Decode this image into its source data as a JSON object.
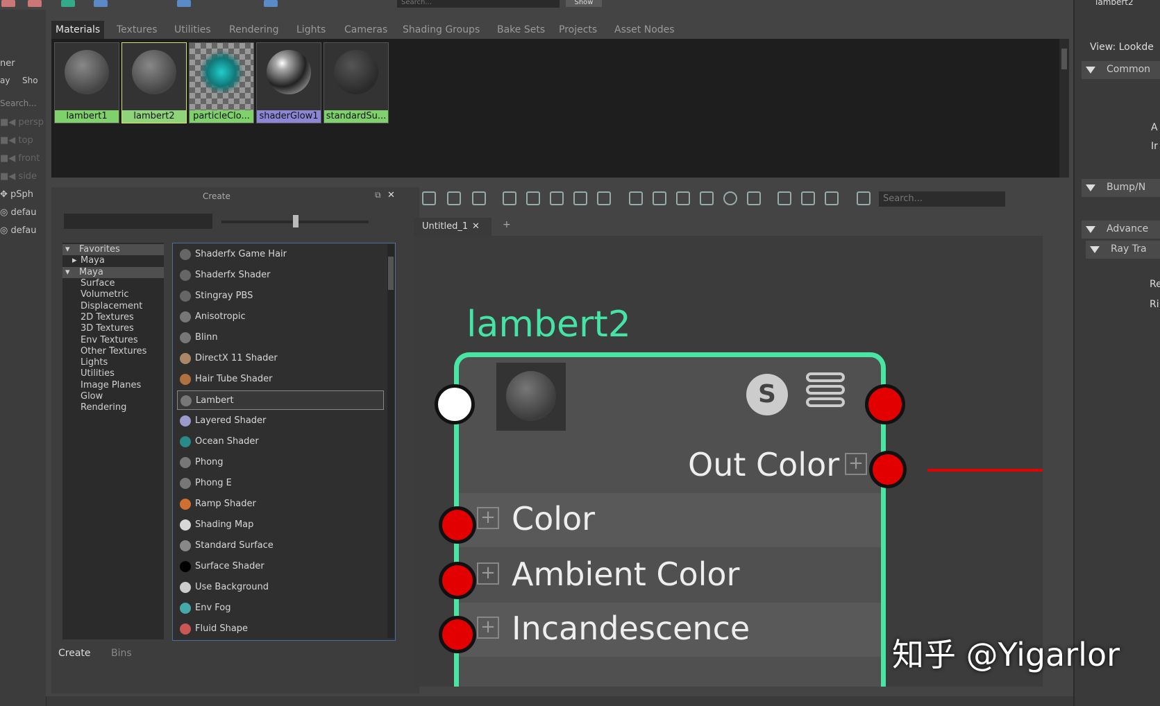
{
  "top_toolbar": {
    "search_placeholder": "Search...",
    "show_button": "Show"
  },
  "outliner": {
    "header_fragments": [
      "ner",
      "ay",
      "Sho"
    ],
    "search_placeholder": "Search...",
    "cameras": [
      "persp",
      "top",
      "front",
      "side"
    ],
    "objects": [
      "pSph",
      "defau",
      "defau"
    ]
  },
  "browser": {
    "tabs": [
      "Materials",
      "Textures",
      "Utilities",
      "Rendering",
      "Lights",
      "Cameras",
      "Shading Groups",
      "Bake Sets",
      "Projects",
      "Asset Nodes"
    ],
    "active_tab": "Materials",
    "swatches": [
      {
        "label": "lambert1",
        "label_bg": "#7ed16b",
        "ball": "lambert"
      },
      {
        "label": "lambert2",
        "label_bg": "#8fd37a",
        "ball": "lambert",
        "selected": true
      },
      {
        "label": "particleClo...",
        "label_bg": "#7ed16b",
        "ball": "checker"
      },
      {
        "label": "shaderGlow1",
        "label_bg": "#8d86d6",
        "ball": "glossy"
      },
      {
        "label": "standardSu...",
        "label_bg": "#7ed16b",
        "ball": "dark"
      }
    ]
  },
  "create_panel": {
    "title": "Create",
    "categories": [
      {
        "label": "Favorites",
        "arrow": "down",
        "level": 0,
        "highlight": true
      },
      {
        "label": "Maya",
        "arrow": "right",
        "level": 1
      },
      {
        "label": "Maya",
        "arrow": "down",
        "level": 0,
        "highlight": true
      },
      {
        "label": "Surface",
        "level": 2
      },
      {
        "label": "Volumetric",
        "level": 2
      },
      {
        "label": "Displacement",
        "level": 2
      },
      {
        "label": "2D Textures",
        "level": 2
      },
      {
        "label": "3D Textures",
        "level": 2
      },
      {
        "label": "Env Textures",
        "level": 2
      },
      {
        "label": "Other Textures",
        "level": 2
      },
      {
        "label": "Lights",
        "level": 2
      },
      {
        "label": "Utilities",
        "level": 2
      },
      {
        "label": "Image Planes",
        "level": 2
      },
      {
        "label": "Glow",
        "level": 2
      },
      {
        "label": "Rendering",
        "level": 2
      }
    ],
    "nodes": [
      {
        "label": "Shaderfx Game Hair",
        "color": "#666"
      },
      {
        "label": "Shaderfx Shader",
        "color": "#666"
      },
      {
        "label": "Stingray PBS",
        "color": "#666"
      },
      {
        "label": "Anisotropic",
        "color": "#777"
      },
      {
        "label": "Blinn",
        "color": "#777"
      },
      {
        "label": "DirectX 11 Shader",
        "color": "#aa8866"
      },
      {
        "label": "Hair Tube Shader",
        "color": "#b07040"
      },
      {
        "label": "Lambert",
        "color": "#777",
        "selected": true
      },
      {
        "label": "Layered Shader",
        "color": "#9a9acc"
      },
      {
        "label": "Ocean Shader",
        "color": "#2a8a8a"
      },
      {
        "label": "Phong",
        "color": "#777"
      },
      {
        "label": "Phong E",
        "color": "#777"
      },
      {
        "label": "Ramp Shader",
        "color": "#d07030"
      },
      {
        "label": "Shading Map",
        "color": "#d8d8d8"
      },
      {
        "label": "Standard Surface",
        "color": "#888"
      },
      {
        "label": "Surface Shader",
        "color": "#000"
      },
      {
        "label": "Use Background",
        "color": "#ccc"
      },
      {
        "label": "Env Fog",
        "color": "#4aa"
      },
      {
        "label": "Fluid Shape",
        "color": "#c55"
      }
    ],
    "bottom_tabs": [
      "Create",
      "Bins"
    ]
  },
  "graph": {
    "search_placeholder": "Search...",
    "tab_label": "Untitled_1",
    "close_glyph": "✕",
    "add_tab": "+",
    "node": {
      "title": "lambert2",
      "badge": "S",
      "output_label": "Out Color",
      "attributes": [
        "Color",
        "Ambient Color",
        "Incandescence"
      ]
    }
  },
  "attribute_editor": {
    "tab_fragment": "lambert2",
    "view_label": "View: Lookde",
    "sections": [
      "Common",
      "Bump/N",
      "Advance",
      "Ray Tra"
    ],
    "fragments": [
      "A",
      "Ir",
      "Re",
      "Ri"
    ]
  },
  "watermark": "知乎 @Yigarlor"
}
